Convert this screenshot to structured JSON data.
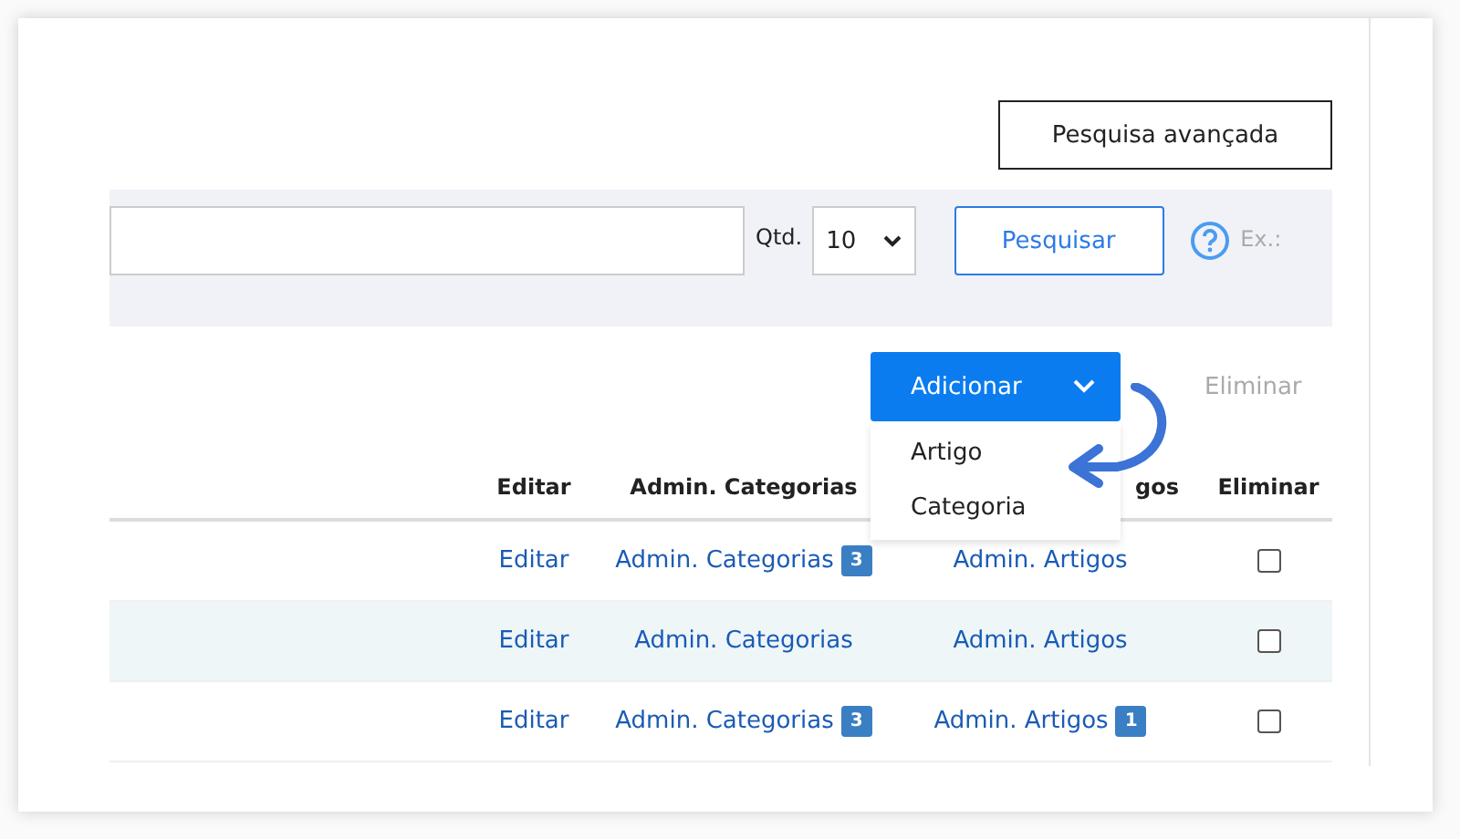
{
  "advanced_search_button": "Pesquisa avançada",
  "search": {
    "quantity_label": "Qtd.",
    "quantity_value": "10",
    "search_button": "Pesquisar",
    "hint": "Ex.:"
  },
  "actions": {
    "add_button": "Adicionar",
    "delete_button": "Eliminar",
    "delete_disabled": true
  },
  "add_menu": {
    "items": [
      "Artigo",
      "Categoria"
    ]
  },
  "table": {
    "columns": [
      "",
      "Editar",
      "Admin. Categorias",
      "gos",
      "Eliminar"
    ],
    "rows": [
      {
        "edit": "Editar",
        "categories": "Admin. Categorias",
        "categories_count": "3",
        "articles": "Admin. Artigos",
        "articles_count": "",
        "checked": false
      },
      {
        "edit": "Editar",
        "categories": "Admin. Categorias",
        "categories_count": "",
        "articles": "Admin. Artigos",
        "articles_count": "",
        "checked": false
      },
      {
        "edit": "Editar",
        "categories": "Admin. Categorias",
        "categories_count": "3",
        "articles": "Admin. Artigos",
        "articles_count": "1",
        "checked": false
      }
    ]
  }
}
